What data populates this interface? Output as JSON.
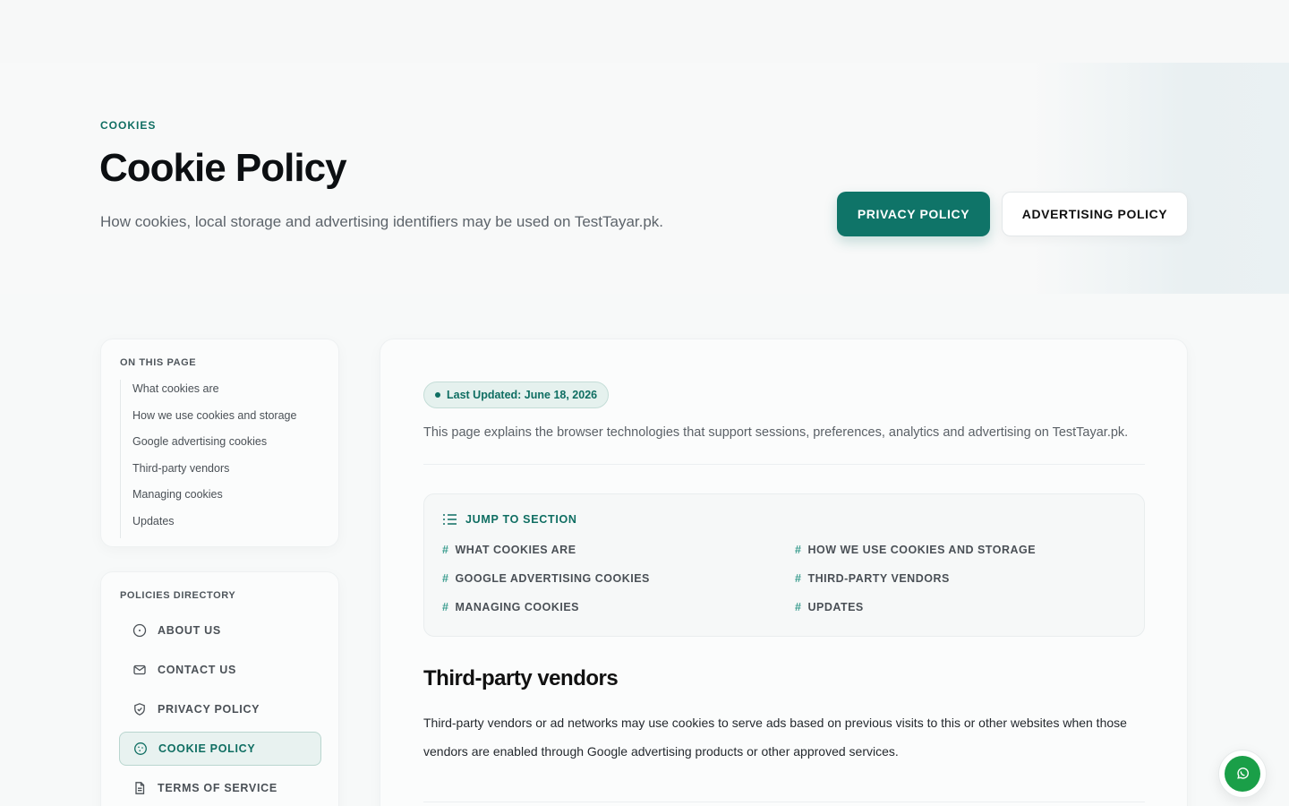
{
  "hero": {
    "eyebrow": "COOKIES",
    "title": "Cookie Policy",
    "subtitle": "How cookies, local storage and advertising identifiers may be used on TestTayar.pk.",
    "primary_button": "PRIVACY POLICY",
    "secondary_button": "ADVERTISING POLICY"
  },
  "toc": {
    "title": "ON THIS PAGE",
    "items": [
      "What cookies are",
      "How we use cookies and storage",
      "Google advertising cookies",
      "Third-party vendors",
      "Managing cookies",
      "Updates"
    ]
  },
  "directory": {
    "title": "POLICIES DIRECTORY",
    "items": [
      {
        "label": "ABOUT US",
        "icon": "info-icon"
      },
      {
        "label": "CONTACT US",
        "icon": "mail-icon"
      },
      {
        "label": "PRIVACY POLICY",
        "icon": "shield-icon"
      },
      {
        "label": "COOKIE POLICY",
        "icon": "cookie-icon",
        "active": true
      },
      {
        "label": "TERMS OF SERVICE",
        "icon": "document-icon"
      }
    ]
  },
  "main": {
    "badge": "Last Updated: June 18, 2026",
    "intro": "This page explains the browser technologies that support sessions, preferences, analytics and advertising on TestTayar.pk.",
    "jump": {
      "title": "JUMP TO SECTION",
      "links": [
        "WHAT COOKIES ARE",
        "HOW WE USE COOKIES AND STORAGE",
        "GOOGLE ADVERTISING COOKIES",
        "THIRD-PARTY VENDORS",
        "MANAGING COOKIES",
        "UPDATES"
      ]
    },
    "section_title": "Third-party vendors",
    "section_body": "Third-party vendors or ad networks may use cookies to serve ads based on previous visits to this or other websites when those vendors are enabled through Google advertising products or other approved services."
  },
  "colors": {
    "brand": "#0f7468",
    "whatsapp": "#1a9f48"
  },
  "floating": {
    "icon": "whatsapp-icon"
  }
}
